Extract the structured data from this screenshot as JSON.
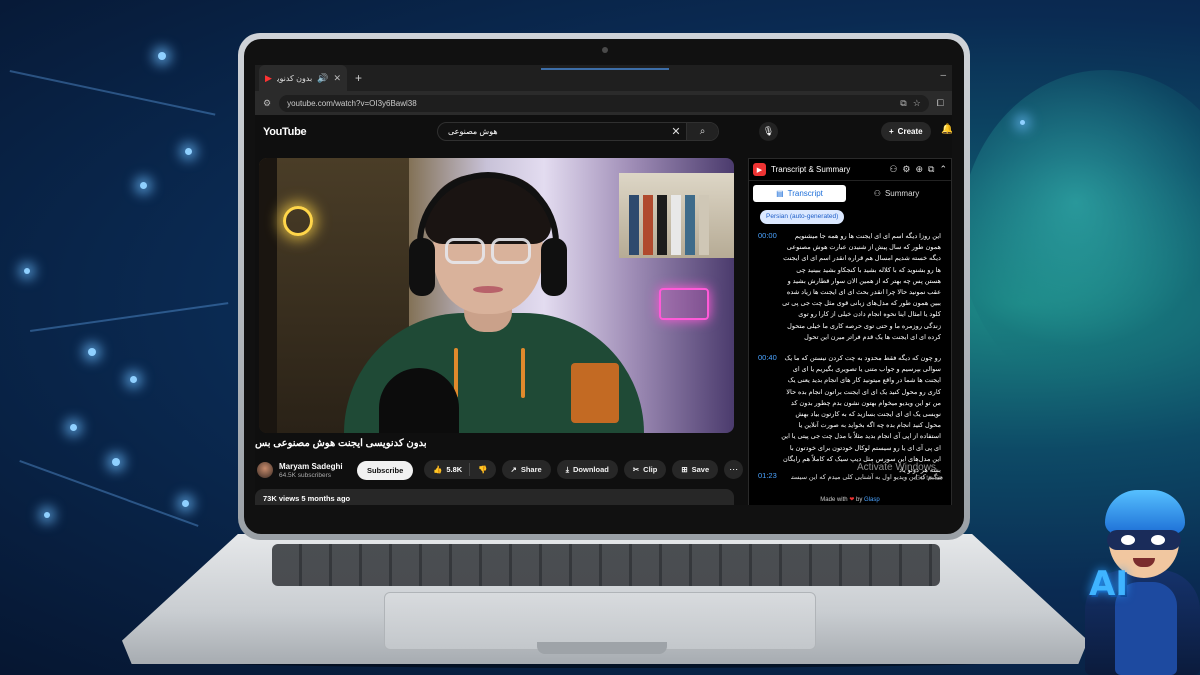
{
  "browser": {
    "tab_title": "بدون کدنویسی ایجنت ه",
    "new_tab_icon": "+",
    "url": "youtube.com/watch?v=OI3y6Bawl38"
  },
  "youtube": {
    "logo_text": "YouTube",
    "search_query": "هوش مصنوعی",
    "create_label": "Create",
    "video": {
      "title": "بدون کدنویسی ایجنت هوش مصنوعی بس",
      "channel_name": "Maryam Sadeghi",
      "subscribers": "64.5K subscribers",
      "subscribe_label": "Subscribe",
      "likes": "5.8K",
      "share_label": "Share",
      "download_label": "Download",
      "clip_label": "Clip",
      "save_label": "Save",
      "views_meta": "73K views  5 months ago"
    }
  },
  "transcript_panel": {
    "title": "Transcript & Summary",
    "tab_transcript": "Transcript",
    "tab_summary": "Summary",
    "language": "Persian (auto-generated)",
    "segments": [
      {
        "time": "00:00",
        "text": "این روزا دیگه اسم ای ای ایجنت ها رو همه جا میشنویم همون طور که سال پیش از شنیدن عبارت هوش مصنوعی دیگه خسته شدیم امسال هم قراره انقدر اسم ای ای ایجنت ها رو بشنوید که با کلاله بشید با کنجکاو بشید ببینید چی هستن پس چه بهتر که از همین الان سوار قطارش بشید و عقب نمونید حالا چرا انقدر بحث ای ای ایجنت ها زیاد شده ببین همون طور که مدل‌های زبانی قوی مثل چت جی پی تی کلود یا امثال اینا نحوه انجام دادن خیلی از کارا رو توی زندگی روزمره ما و حتی توی حرصه کاری ما خیلی متحول کرده ای ای ایجنت ها یک قدم فراتر میرن این تحول"
      },
      {
        "time": "00:40",
        "text": "رو چون که دیگه فقط محدود به چت کردن نیستن که ما یک سوالی بپرسیم و جواب متنی یا تصویری بگیریم یا ای ای ایجنت ها شما در واقع میتونید کار های انجام بدید یعنی یک کاری رو محول کنید یک ای ای ایجنت براتون انجام بده حالا من تو این ویدیو میخوام بهتون نشون بدم چطور بدون کد نویسی یک ای ای ایجنت بسازید که به کارتون بیاد بهش محول کنید انجام بده چه اگه بخواید به صورت آنلاین یا استفاده از اپی آی انجام بدید مثلاً با مدل چت جی پیتی یا این ای پی آی ای یا رو سیستم لوکال خودتون برای خودتون با این مدل‌های این سورس مثل دیپ سیک که کاملاً هم رایگان بشه هر دوتو یاد"
      }
    ],
    "last_time": "01:23",
    "last_line": "میگیم که این ویدیو اول به آشنایی کلی میدم که این سیستمهای",
    "watermark_title": "Activate Windows",
    "watermark_sub": "Go to Se",
    "made_with": "Made with",
    "made_by": "by",
    "made_brand": "Glasp"
  },
  "mascot": {
    "badge_text": "AI"
  },
  "colors": {
    "accent_blue": "#4aa3ff",
    "youtube_bg": "#0f0f0f",
    "background_teal": "#1d8a86"
  },
  "icons": [
    "speaker-icon",
    "close-icon",
    "cast-icon",
    "star-icon",
    "extensions-icon",
    "search-icon",
    "mic-icon",
    "bell-icon",
    "like-icon",
    "dislike-icon",
    "share-icon",
    "download-icon",
    "clip-icon",
    "save-icon",
    "more-icon",
    "gear-icon",
    "copy-icon",
    "chevron-up-icon"
  ]
}
